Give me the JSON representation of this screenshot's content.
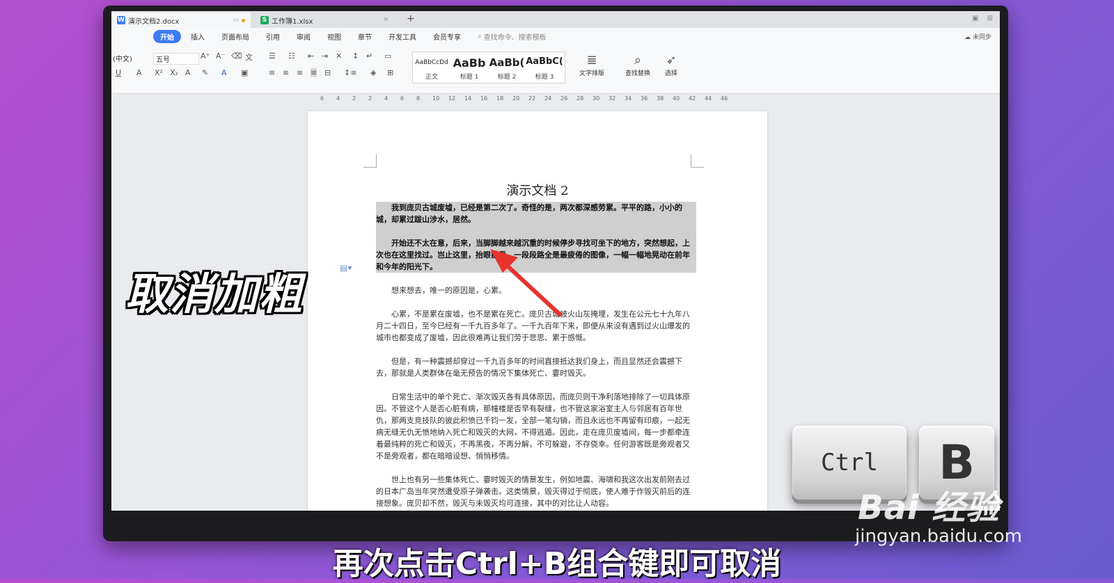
{
  "tabs": [
    {
      "name": "演示文档2.docx",
      "icon_letter": "W",
      "icon_color": "#3c7bf0"
    },
    {
      "name": "工作簿1.xlsx",
      "icon_letter": "S",
      "icon_color": "#1fa95c"
    }
  ],
  "menu": [
    "开始",
    "插入",
    "页面布局",
    "引用",
    "审阅",
    "视图",
    "章节",
    "开发工具",
    "会员专享"
  ],
  "active_menu": "开始",
  "search_placeholder": "查找命令、搜索模板",
  "sync_label": "未同步",
  "toolbar": {
    "font_name": "(中文)",
    "font_size": "五号",
    "styles": [
      {
        "preview": "AaBbCcDd",
        "caption": "正文"
      },
      {
        "preview": "AaBb",
        "caption": "标题 1"
      },
      {
        "preview": "AaBb(",
        "caption": "标题 2"
      },
      {
        "preview": "AaBbC(",
        "caption": "标题 3"
      }
    ],
    "text_layout": "文字排版",
    "find_replace": "查找替换",
    "select": "选择"
  },
  "ruler_numbers": [
    "6",
    "4",
    "2",
    "2",
    "4",
    "6",
    "8",
    "10",
    "12",
    "14",
    "16",
    "18",
    "20",
    "22",
    "24",
    "26",
    "28",
    "30",
    "32",
    "34",
    "36",
    "38",
    "40",
    "42",
    "44",
    "46"
  ],
  "document": {
    "title": "演示文档 2",
    "paragraphs": [
      {
        "text": "我到庞贝古城废墟，已经是第二次了。奇怪的是，两次都深感劳累。平平的路，小小的城，却累过跋山涉水，居然。",
        "selected": true
      },
      {
        "text": "开始还不太在意，后来，当脚脚越来越沉重的时候停步寻找可坐下的地方，突然想起，上次也在这里找过。岂止这里，抬眼前看，一段段路全是最疲倦的图像，一幅一幅地晃动在前年和今年的阳光下。",
        "selected": true
      },
      {
        "text": "想来想去，唯一的原因是，心累。",
        "selected": false
      },
      {
        "text": "心累，不是累在废墟，也不是累在死亡。庞贝古城被火山灰掩埋，发生在公元七十九年八月二十四日，至今已经有一千九百多年了。一千九百年下来，即便从来没有遇到过火山爆发的城市也都变成了废墟，因此很难再让我们劳于悲思、累于感慨。",
        "selected": false
      },
      {
        "text": "但是，有一种震撼却穿过一千九百多年的时间直接抵达我们身上，而且显然还会震撼下去，那就是人类群体在毫无预告的情况下集体死亡、霎时毁灭。",
        "selected": false
      },
      {
        "text": "日常生活中的单个死亡、渐次毁灭各有具体原因，而庞贝则干净利落地排除了一切具体原因。不管这个人是否心脏有病，那幢楼是否早有裂缝，也不管这家浴室主人与邻居有百年世仇，那两支竞技队的彼此积愤已千钧一发，全部一笔勾销，而且永远也不再留有印痕，一起无病无缝无仇无愤地纳入死亡和毁灭的大网，不得逃遁。因此，走在庞贝废墟间，每一步都牵连着最纯粹的死亡和毁灭，不再黑夜，不再分解，不可躲避，不存侥幸。任何游客既是旁观者又不是旁观者，都在暗暗设想、悄悄移情。",
        "selected": false
      },
      {
        "text": "世上也有另一些集体死亡、霎时毁灭的情景发生，例如地震、海啸和我这次出发前刚去过的日本广岛当年突然遭受原子弹袭击。这类情景，毁灭得过于彻底，使人难于作毁灭前后的连接想象。庞贝却不然，毁灭与未毁灭均可连接，其中的对比让人动容。",
        "selected": false
      }
    ]
  },
  "overlay": {
    "title": "取消加粗",
    "key1": "Ctrl",
    "key2": "B",
    "subtitle": "再次点击Ctrl+B组合键即可取消",
    "watermark": "Bai 经验",
    "watermark_url": "jingyan.baidu.com"
  },
  "colors": {
    "accent": "#3c7bf0",
    "arrow": "#e8322c",
    "selection": "#cfcfcf"
  }
}
